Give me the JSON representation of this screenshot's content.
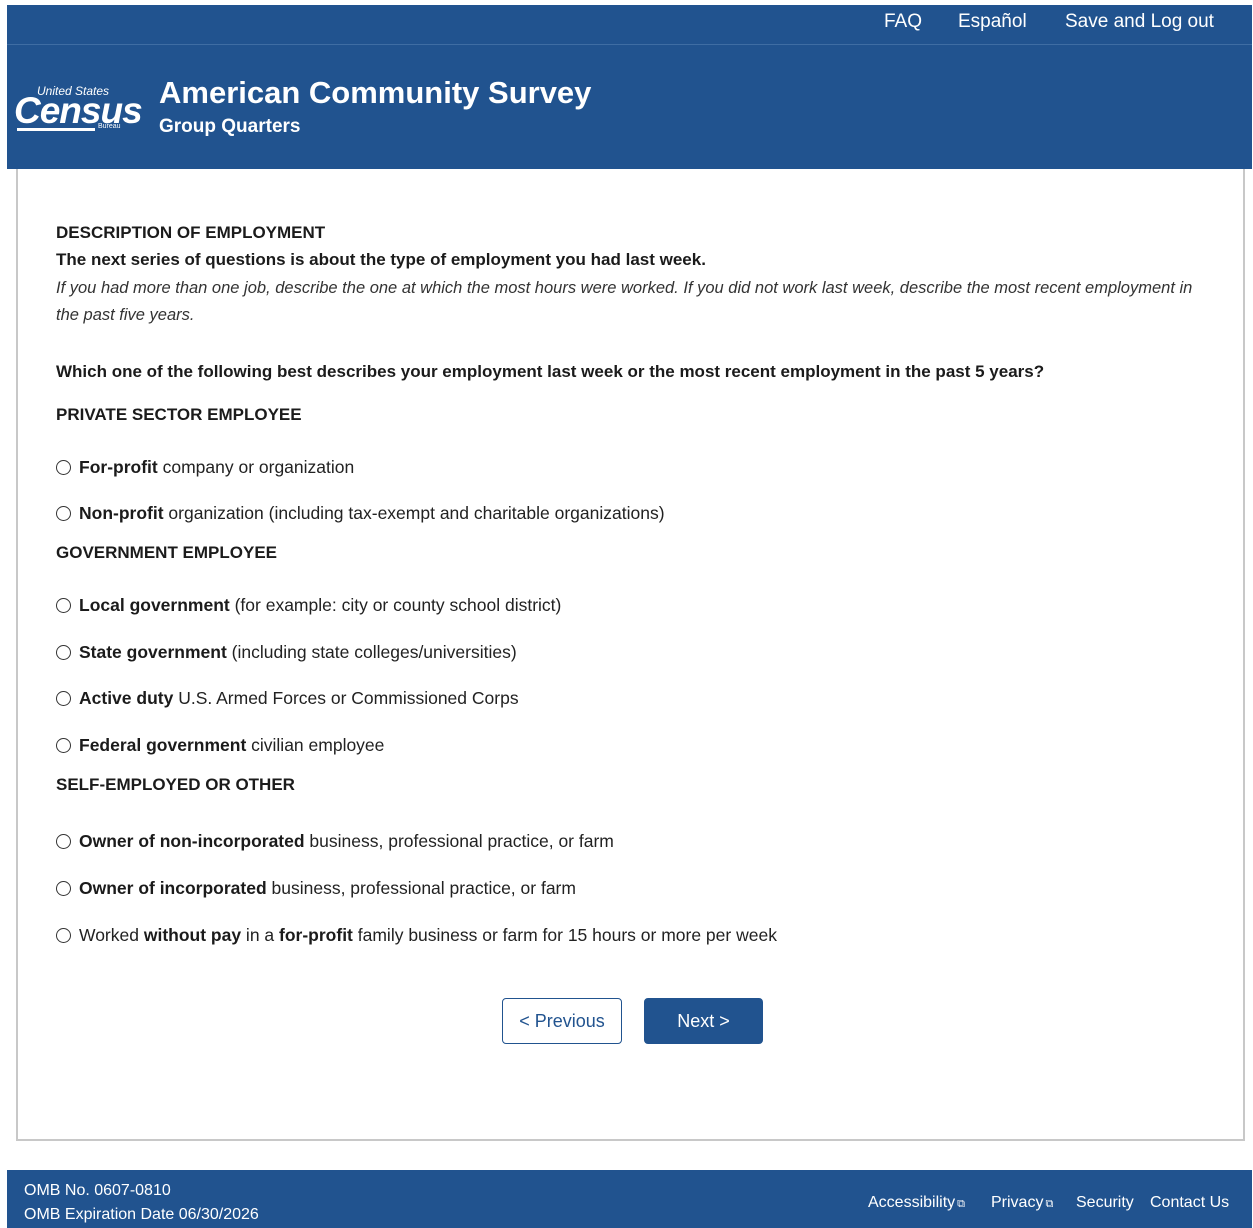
{
  "header": {
    "utility_links": {
      "faq": "FAQ",
      "espanol": "Español",
      "save_logout": "Save and Log out"
    },
    "logo": {
      "line1": "United States",
      "line2": "Census",
      "line3": "Bureau"
    },
    "title": "American Community Survey",
    "subtitle": "Group Quarters"
  },
  "main": {
    "section_title": "DESCRIPTION OF EMPLOYMENT",
    "intro": "The next series of questions is about the type of employment you had last week.",
    "note": "If you had more than one job, describe the one at which the most hours were worked. If you did not work last week, describe the most recent employment in the past five years.",
    "question": "Which one of the following best describes your employment last week or the most recent employment in the past 5 years?",
    "groups": {
      "private": "PRIVATE SECTOR EMPLOYEE",
      "government": "GOVERNMENT EMPLOYEE",
      "self": "SELF-EMPLOYED OR OTHER"
    },
    "options": {
      "for_profit": {
        "bold": "For-profit",
        "rest": " company or organization"
      },
      "non_profit": {
        "bold": "Non-profit",
        "rest": " organization (including tax-exempt and charitable organizations)"
      },
      "local_gov": {
        "bold": "Local government",
        "rest": " (for example: city or county school district)"
      },
      "state_gov": {
        "bold": "State government",
        "rest": " (including state colleges/universities)"
      },
      "active_duty": {
        "bold": "Active duty",
        "rest": " U.S. Armed Forces or Commissioned Corps"
      },
      "federal_gov": {
        "bold": "Federal government",
        "rest": " civilian employee"
      },
      "owner_nonincorp": {
        "bold": "Owner of non-incorporated",
        "rest": " business, professional practice, or farm"
      },
      "owner_incorp": {
        "bold": "Owner of incorporated",
        "rest": " business, professional practice, or farm"
      },
      "without_pay": {
        "t1": "Worked ",
        "b1": "without pay",
        "t2": " in a ",
        "b2": "for-profit",
        "t3": " family business or farm for 15 hours or more per week"
      }
    },
    "buttons": {
      "previous": "< Previous",
      "next": "Next >"
    }
  },
  "footer": {
    "omb_number": "OMB No. 0607-0810",
    "omb_expiration": "OMB Expiration Date 06/30/2026",
    "links": {
      "accessibility": "Accessibility",
      "privacy": "Privacy",
      "security": "Security",
      "contact": "Contact Us"
    },
    "external_icon": "external-link-icon"
  },
  "colors": {
    "brand_blue": "#21538f",
    "border_gray": "#c8c8c8"
  }
}
